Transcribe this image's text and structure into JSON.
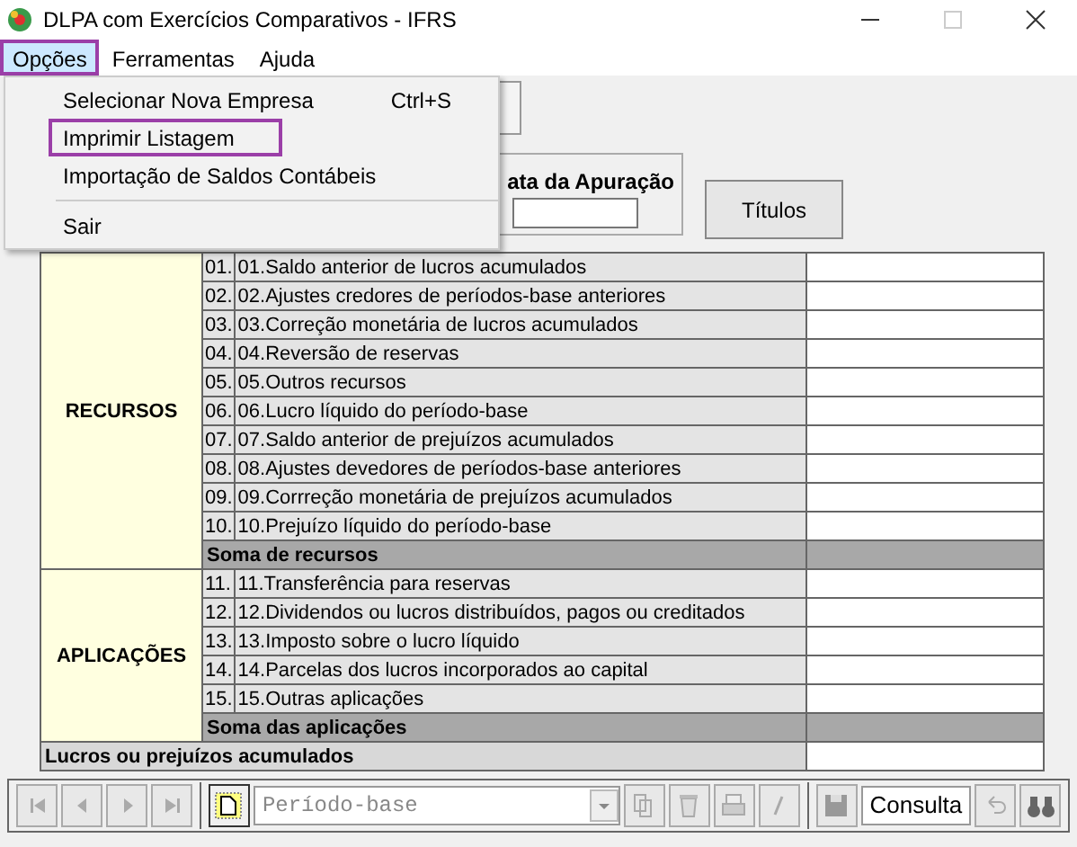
{
  "window": {
    "title": "DLPA com Exercícios Comparativos - IFRS"
  },
  "menu_bar": [
    {
      "label": "Opções",
      "selected": true
    },
    {
      "label": "Ferramentas",
      "selected": false
    },
    {
      "label": "Ajuda",
      "selected": false
    }
  ],
  "dropdown": [
    {
      "label": "Selecionar Nova Empresa",
      "shortcut": "Ctrl+S",
      "selected": false,
      "separator_before": false
    },
    {
      "label": "Imprimir Listagem",
      "selected": true,
      "separator_before": false
    },
    {
      "label": "Importação de Saldos Contábeis",
      "selected": false,
      "separator_before": false
    },
    {
      "label": "Sair",
      "selected": false,
      "separator_before": true
    }
  ],
  "date_group": {
    "label": "ata da Apuração"
  },
  "titles_button": "Títulos",
  "table": {
    "sections": [
      {
        "label": "RECURSOS",
        "rows": [
          {
            "code": "01.",
            "text": "01.Saldo anterior de lucros acumulados"
          },
          {
            "code": "02.",
            "text": "02.Ajustes credores de períodos-base anteriores"
          },
          {
            "code": "03.",
            "text": "03.Correção monetária de lucros acumulados"
          },
          {
            "code": "04.",
            "text": "04.Reversão de reservas"
          },
          {
            "code": "05.",
            "text": "05.Outros recursos"
          },
          {
            "code": "06.",
            "text": "06.Lucro líquido do período-base"
          },
          {
            "code": "07.",
            "text": "07.Saldo anterior de prejuízos acumulados"
          },
          {
            "code": "08.",
            "text": "08.Ajustes devedores de períodos-base anteriores"
          },
          {
            "code": "09.",
            "text": "09.Corrreção monetária de prejuízos acumulados"
          },
          {
            "code": "10.",
            "text": "10.Prejuízo líquido do período-base"
          }
        ],
        "total": "Soma de recursos"
      },
      {
        "label": "APLICAÇÕES",
        "rows": [
          {
            "code": "11.",
            "text": "11.Transferência para reservas"
          },
          {
            "code": "12.",
            "text": "12.Dividendos ou lucros distribuídos, pagos ou creditados"
          },
          {
            "code": "13.",
            "text": "13.Imposto sobre o lucro líquido"
          },
          {
            "code": "14.",
            "text": "14.Parcelas dos lucros incorporados ao capital"
          },
          {
            "code": "15.",
            "text": "15.Outras aplicações"
          }
        ],
        "total": "Soma das aplicações"
      }
    ],
    "final": "Lucros ou prejuízos acumulados"
  },
  "toolbar": {
    "period": {
      "value": "Período-base",
      "disabled": true
    },
    "mode": "Consulta"
  }
}
